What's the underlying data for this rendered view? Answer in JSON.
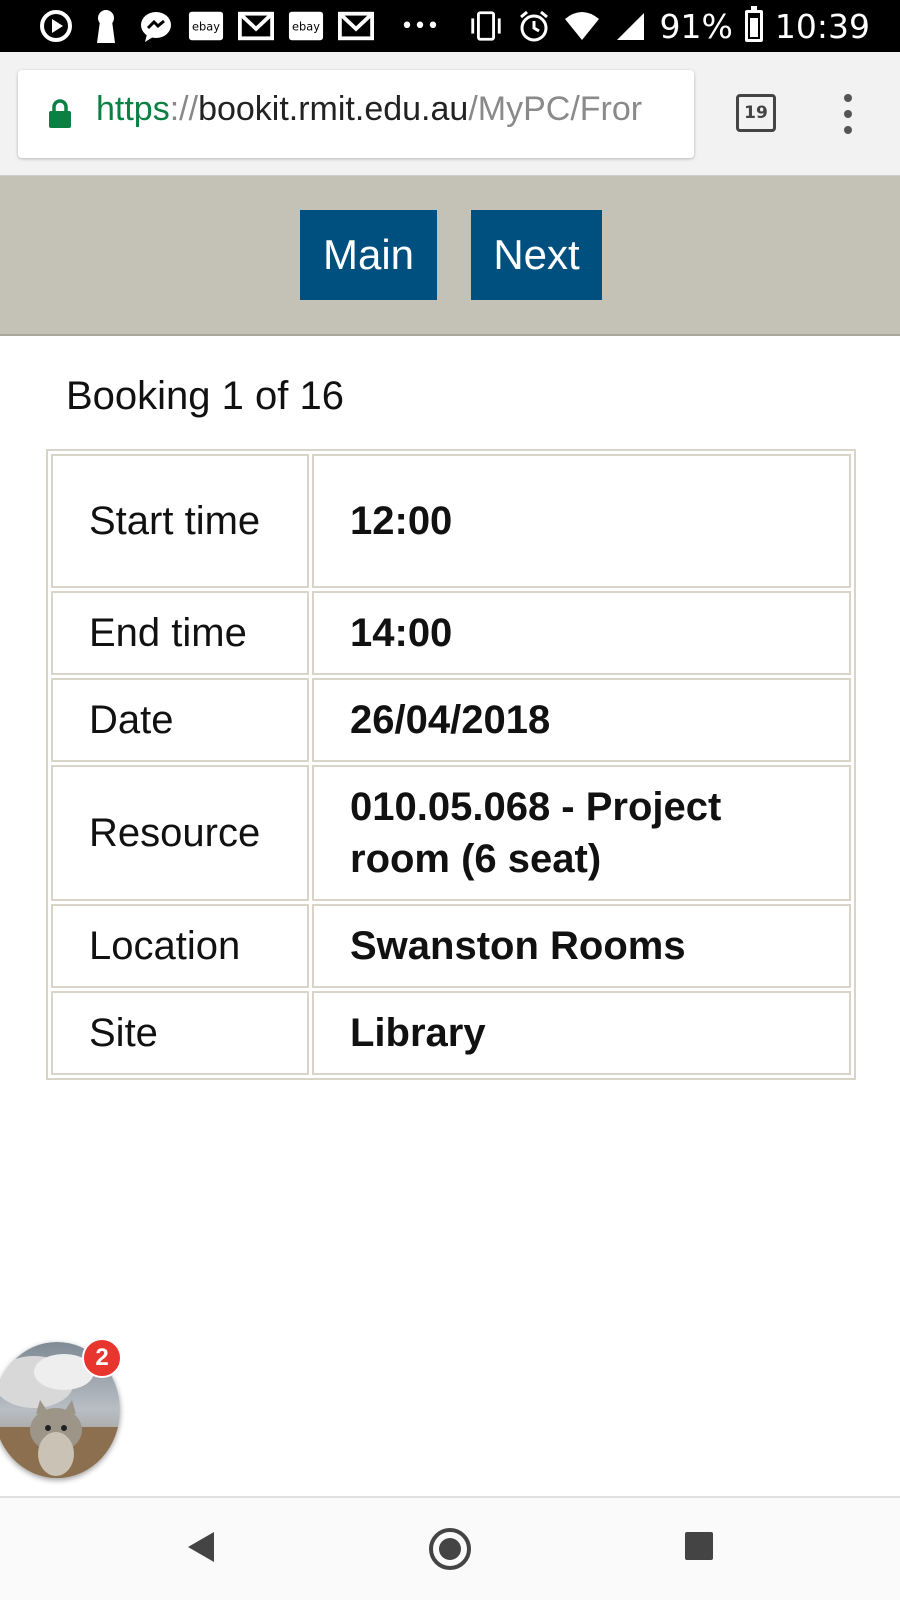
{
  "status_bar": {
    "battery": "91%",
    "time": "10:39",
    "notification_icons": [
      "play-icon",
      "keyhole-icon",
      "messenger-icon",
      "ebay-icon",
      "gmail-icon",
      "ebay-icon",
      "gmail-icon",
      "more-dots-icon"
    ],
    "ebay_label": "ebay",
    "overflow": "•••"
  },
  "browser": {
    "url_scheme": "https",
    "url_sep": "://",
    "url_host": "bookit.rmit.edu.au",
    "url_path": "/MyPC/Fror",
    "tab_count": "19"
  },
  "nav": {
    "main_label": "Main",
    "next_label": "Next",
    "button_color": "#00507f",
    "band_color": "#c4c2b6"
  },
  "booking": {
    "heading": "Booking 1 of 16",
    "rows": [
      {
        "label": "Start time",
        "value": "12:00"
      },
      {
        "label": "End time",
        "value": "14:00"
      },
      {
        "label": "Date",
        "value": "26/04/2018"
      },
      {
        "label": "Resource",
        "value": "010.05.068 - Project room (6 seat)"
      },
      {
        "label": "Location",
        "value": "Swanston Rooms"
      },
      {
        "label": "Site",
        "value": "Library"
      }
    ]
  },
  "chat_head": {
    "badge_count": "2"
  },
  "system_nav": {
    "icons": [
      "back-icon",
      "home-icon",
      "recents-icon"
    ]
  }
}
